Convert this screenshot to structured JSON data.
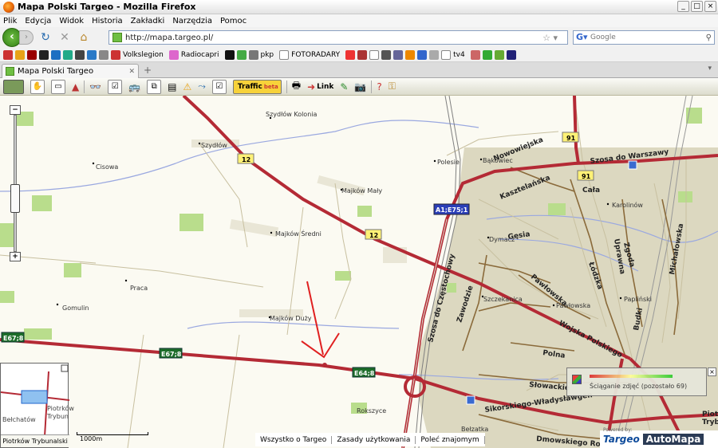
{
  "window": {
    "title": "Mapa Polski Targeo - Mozilla Firefox"
  },
  "menu": [
    "Plik",
    "Edycja",
    "Widok",
    "Historia",
    "Zakładki",
    "Narzędzia",
    "Pomoc"
  ],
  "address": {
    "url": "http://mapa.targeo.pl/"
  },
  "search": {
    "placeholder": "Google"
  },
  "bookmarks": [
    "Volkslegion",
    "Radiocapri",
    "pkp",
    "FOTORADARY",
    "tv4"
  ],
  "tab": {
    "label": "Mapa Polski Targeo"
  },
  "map_toolbar": {
    "link_label": "Link",
    "traffic_label": "Traffic",
    "traffic_sub": "beta"
  },
  "places": [
    "Szydłów Kolonia",
    "Szydłów",
    "Cisowa",
    "Majków Mały",
    "Majków Średni",
    "Praca",
    "Gomulin",
    "Majków Duży",
    "Polesie",
    "Bąkowiec",
    "Cała",
    "Karolinów",
    "Dymacz",
    "Szczekanica",
    "Pawłowska",
    "Papliński",
    "Rokszyce",
    "Bełzatka"
  ],
  "streets": [
    "Nowowiejska",
    "Szosa do Warszawy",
    "Kasztelańska",
    "Gęsia",
    "Pawłowska",
    "Zawodzie",
    "Szosa do Częstochowy",
    "Wojska Polskiego",
    "Polna",
    "Słowackie",
    "Sikorskiego-Władysławgen",
    "Łódzka",
    "Dmowskiego Rom",
    "Michałowska",
    "Budki",
    "Uprawna",
    "Zgoda"
  ],
  "road_shields": {
    "r12a": "12",
    "r12b": "12",
    "r91a": "91",
    "r91b": "91",
    "a1": "A1;E75;1",
    "e67a": "E67;8",
    "e67b": "E67;8",
    "e64": "E64;8"
  },
  "minimap": {
    "name": "Piotrków Trybunalski",
    "labels": [
      "Bełchatów",
      "Piotrków",
      "Trybun"
    ]
  },
  "scale": {
    "label": "1000m"
  },
  "footer": {
    "links": [
      "Wszystko o Targeo",
      "Zasady użytkowania",
      "Poleć znajomym"
    ]
  },
  "brand": {
    "powered_by": "Powered by:",
    "targeo": "Targeo",
    "automapa": "AutoMapa"
  },
  "download": {
    "text": "Ściąganie zdjęć (pozostało 69)"
  },
  "edge_labels": {
    "right1": "Piotrkó",
    "right2": "Trybu"
  }
}
